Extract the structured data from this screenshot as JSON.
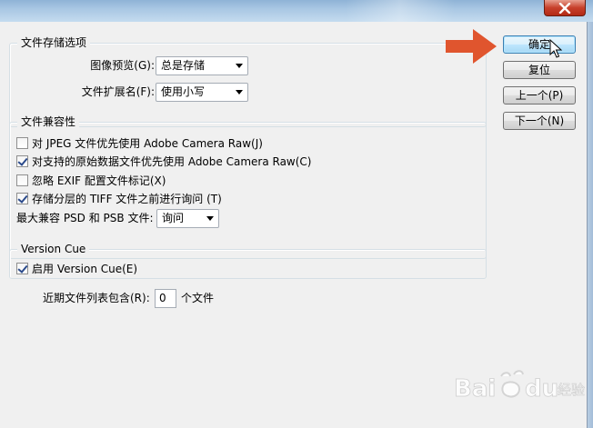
{
  "titlebar": {
    "close_icon": "close-icon"
  },
  "file_options": {
    "legend": "文件存储选项",
    "preview_label": "图像预览(G):",
    "preview_value": "总是存储",
    "extension_label": "文件扩展名(F):",
    "extension_value": "使用小写"
  },
  "compatibility": {
    "legend": "文件兼容性",
    "items": [
      {
        "label": "对 JPEG 文件优先使用 Adobe Camera Raw(J)",
        "checked": false
      },
      {
        "label": "对支持的原始数据文件优先使用 Adobe Camera Raw(C)",
        "checked": true
      },
      {
        "label": "忽略 EXIF 配置文件标记(X)",
        "checked": false
      },
      {
        "label": "存储分层的 TIFF 文件之前进行询问 (T)",
        "checked": true
      }
    ],
    "maximize_label": "最大兼容 PSD 和 PSB 文件:",
    "maximize_value": "询问"
  },
  "version_cue": {
    "legend": "Version Cue",
    "enable_label": "启用 Version Cue(E)",
    "enable_checked": true
  },
  "recent_files": {
    "label": "近期文件列表包含(R):",
    "value": "0",
    "suffix": "个文件"
  },
  "buttons": {
    "ok": "确定",
    "reset": "复位",
    "prev": "上一个(P)",
    "next": "下一个(N)"
  },
  "watermark": {
    "text": "Bai du 经验"
  },
  "colors": {
    "arrow": "#e0552e",
    "accent": "#3c7fb1"
  }
}
